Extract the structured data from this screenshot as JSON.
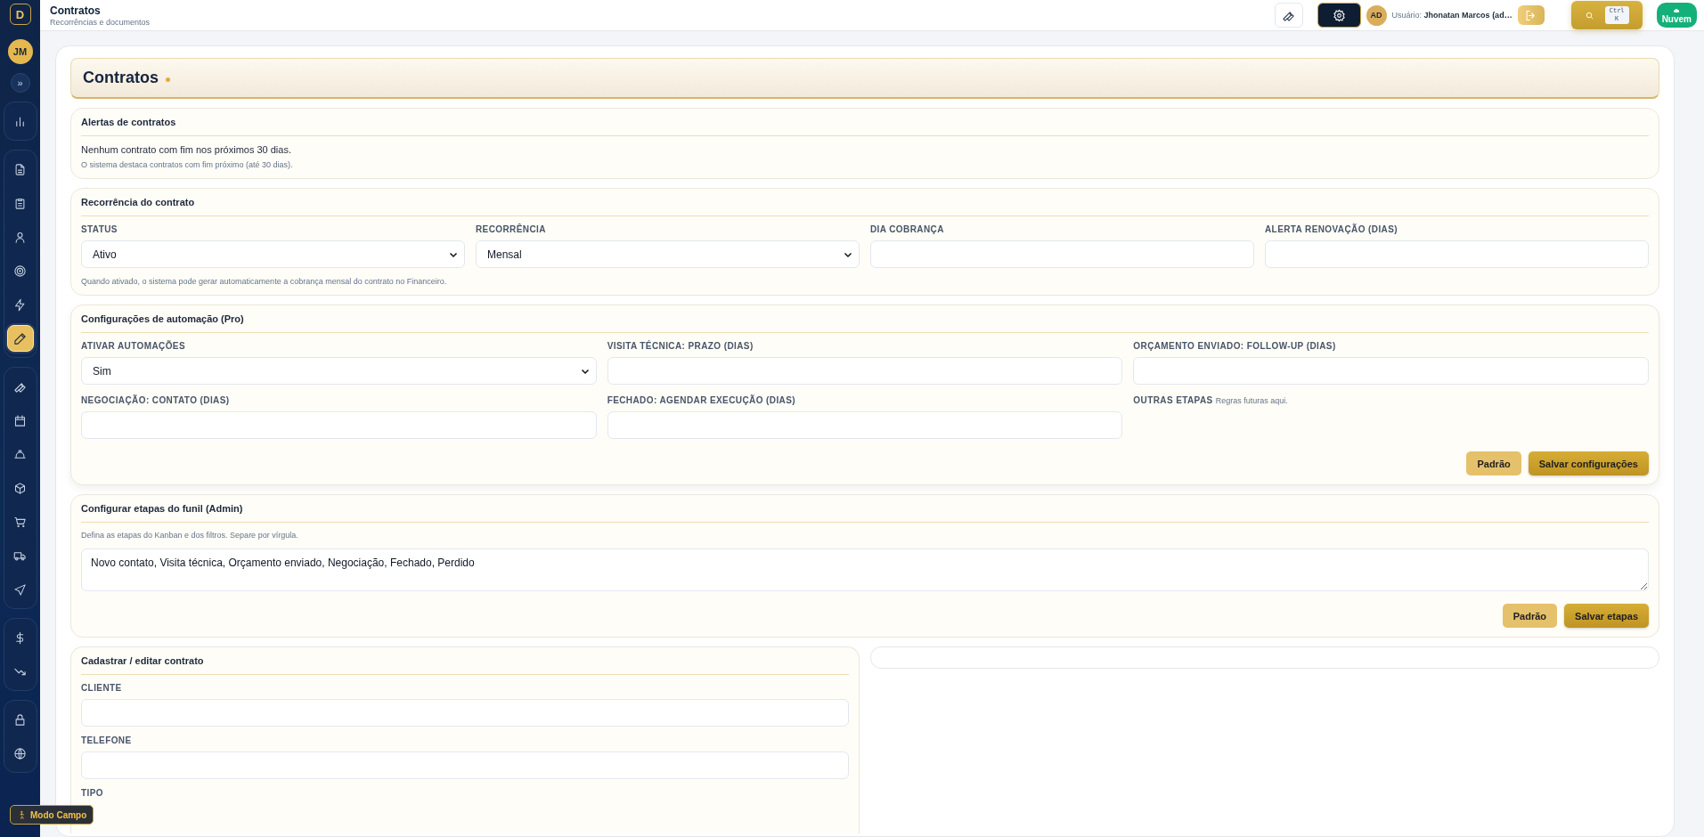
{
  "sidebar": {
    "logo": "D",
    "avatar": "JM",
    "expand": "»",
    "groups": [
      [
        {
          "selected": false
        }
      ],
      [
        {
          "selected": false
        },
        {
          "selected": false
        },
        {
          "selected": false
        },
        {
          "selected": false
        },
        {
          "selected": false
        },
        {
          "selected": true
        }
      ],
      [
        {
          "selected": false
        },
        {
          "selected": false
        },
        {
          "selected": false
        },
        {
          "selected": false
        },
        {
          "selected": false
        },
        {
          "selected": false
        },
        {
          "selected": false
        }
      ],
      [
        {
          "selected": false
        },
        {
          "selected": false
        }
      ],
      [
        {
          "selected": false
        },
        {
          "selected": false
        }
      ]
    ],
    "field_mode_button": "Modo Campo"
  },
  "header": {
    "title": "Contratos",
    "subtitle": "Recorrências e documentos",
    "user_avatar": "AD",
    "user_label": "Usuário: **Jhonatan Marcos (ad…**",
    "shortcut": [
      "Ctrl",
      "K"
    ],
    "cloud_button": "Nuvem"
  },
  "page_title": "Contratos",
  "alerts": {
    "title": "Alertas de contratos",
    "message": "Nenhum contrato com fim nos próximos 30 dias.",
    "hint": "O sistema destaca contratos com fim próximo (até 30 dias)."
  },
  "recurrence": {
    "title": "Recorrência do contrato",
    "fields": [
      {
        "label": "STATUS",
        "kind": "select",
        "value": "Ativo"
      },
      {
        "label": "RECORRÊNCIA",
        "kind": "select",
        "value": "Mensal"
      },
      {
        "label": "DIA COBRANÇA",
        "kind": "input"
      },
      {
        "label": "ALERTA RENOVAÇÃO (DIAS)",
        "kind": "input"
      }
    ],
    "hint": "Quando ativado, o sistema pode gerar automaticamente a cobrança mensal do contrato no Financeiro."
  },
  "automation": {
    "title": "Configurações de automação (Pro)",
    "fields": [
      {
        "label": "ATIVAR AUTOMAÇÕES",
        "kind": "select",
        "value": "Sim"
      },
      {
        "label": "VISITA TÉCNICA: PRAZO (DIAS)",
        "kind": "input"
      },
      {
        "label": "ORÇAMENTO ENVIADO: FOLLOW-UP (DIAS)",
        "kind": "input"
      },
      {
        "label": "NEGOCIAÇÃO: CONTATO (DIAS)",
        "kind": "input"
      },
      {
        "label": "FECHADO: AGENDAR EXECUÇÃO (DIAS)",
        "kind": "input"
      },
      {
        "label": "OUTRAS ETAPAS",
        "kind": "note",
        "note": "Regras futuras aqui."
      }
    ],
    "buttons": [
      "Padrão",
      "Salvar configurações"
    ]
  },
  "funnel": {
    "title": "Configurar etapas do funil (Admin)",
    "hint": "Defina as etapas do Kanban e dos filtros. Separe por vírgula.",
    "value": "Novo contato, Visita técnica, Orçamento enviado, Negociação, Fechado, Perdido",
    "buttons": [
      "Padrão",
      "Salvar etapas"
    ]
  },
  "contract_form": {
    "title": "Cadastrar / editar contrato",
    "fields": [
      {
        "label": "CLIENTE",
        "kind": "input"
      },
      {
        "label": "TELEFONE",
        "kind": "input"
      },
      {
        "label": "TIPO",
        "kind": "label"
      }
    ]
  }
}
